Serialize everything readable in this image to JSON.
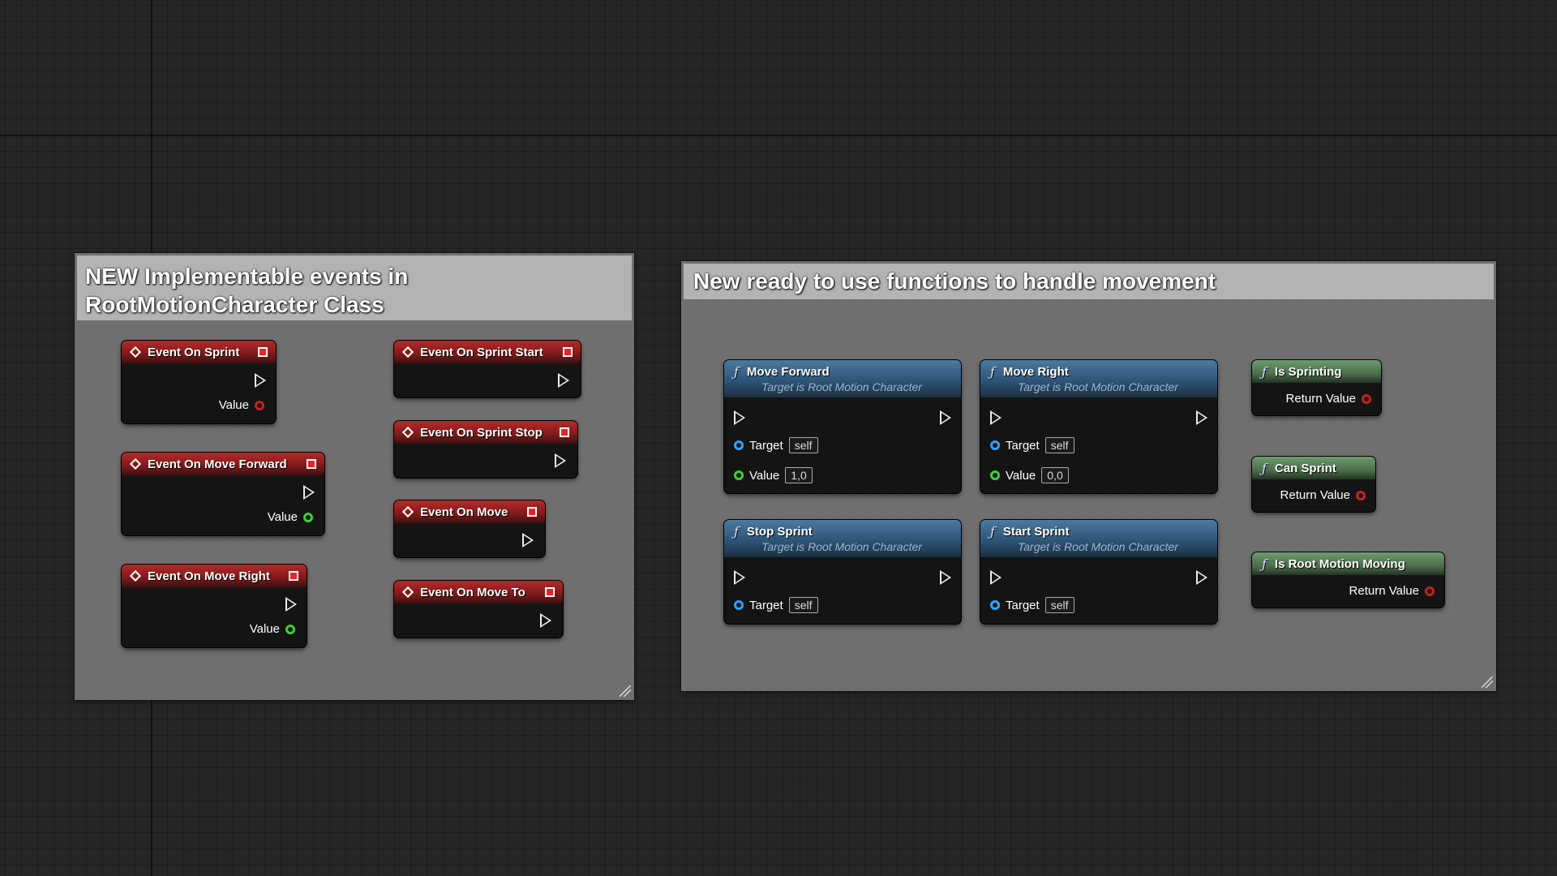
{
  "comments": [
    {
      "title_line1": "NEW Implementable events in",
      "title_line2": "RootMotionCharacter Class"
    },
    {
      "title": "New ready to use functions to handle movement"
    }
  ],
  "events": {
    "on_sprint": {
      "title": "Event On Sprint",
      "pin": "Value"
    },
    "on_move_forward": {
      "title": "Event On Move Forward",
      "pin": "Value"
    },
    "on_move_right": {
      "title": "Event On Move Right",
      "pin": "Value"
    },
    "on_sprint_start": {
      "title": "Event On Sprint Start"
    },
    "on_sprint_stop": {
      "title": "Event On Sprint Stop"
    },
    "on_move": {
      "title": "Event On Move"
    },
    "on_move_to": {
      "title": "Event On Move To"
    }
  },
  "functions": {
    "move_forward": {
      "title": "Move Forward",
      "subtitle": "Target is Root Motion Character",
      "target_label": "Target",
      "target_value": "self",
      "value_label": "Value",
      "value": "1,0"
    },
    "move_right": {
      "title": "Move Right",
      "subtitle": "Target is Root Motion Character",
      "target_label": "Target",
      "target_value": "self",
      "value_label": "Value",
      "value": "0,0"
    },
    "stop_sprint": {
      "title": "Stop Sprint",
      "subtitle": "Target is Root Motion Character",
      "target_label": "Target",
      "target_value": "self"
    },
    "start_sprint": {
      "title": "Start Sprint",
      "subtitle": "Target is Root Motion Character",
      "target_label": "Target",
      "target_value": "self"
    }
  },
  "pure_functions": {
    "is_sprinting": {
      "title": "Is Sprinting",
      "pin": "Return Value"
    },
    "can_sprint": {
      "title": "Can Sprint",
      "pin": "Return Value"
    },
    "is_root_motion_moving": {
      "title": "Is Root Motion Moving",
      "pin": "Return Value"
    }
  },
  "icons": {
    "event": "event-diamond-icon",
    "function": "function-f-icon",
    "exec": "exec-pin-icon",
    "delegate": "delegate-pin-icon"
  },
  "colors": {
    "event_header": "#b52a2a",
    "function_header": "#2e5577",
    "pure_header": "#4b6f4b",
    "bool_pin": "#cc1f1f",
    "float_pin": "#36d331",
    "object_pin": "#2aa3ff"
  }
}
